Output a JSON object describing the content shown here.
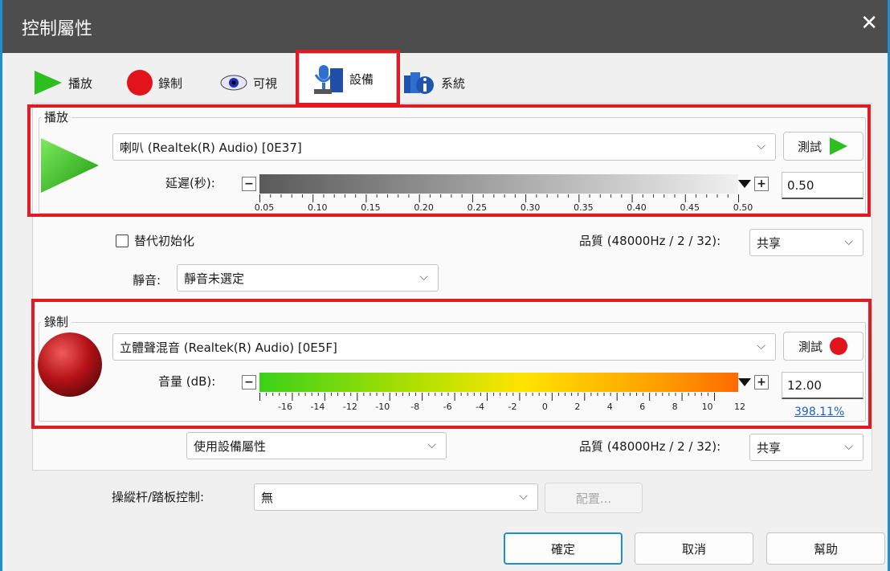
{
  "window": {
    "title": "控制屬性",
    "close_glyph": "✕"
  },
  "tabs": [
    {
      "label": "播放",
      "icon": "play-icon"
    },
    {
      "label": "錄制",
      "icon": "record-icon"
    },
    {
      "label": "可視",
      "icon": "eye-icon"
    },
    {
      "label": "設備",
      "icon": "device-icon",
      "active": true
    },
    {
      "label": "系統",
      "icon": "system-info-icon"
    }
  ],
  "playback": {
    "group_label": "播放",
    "device": "喇叭 (Realtek(R) Audio) [0E37]",
    "test_label": "測試",
    "latency_label": "延遲(秒):",
    "latency_value": "0.50",
    "latency_level": 1.0,
    "latency_ticks": [
      "0.05",
      "0.10",
      "0.15",
      "0.20",
      "0.25",
      "0.30",
      "0.35",
      "0.40",
      "0.45",
      "0.50"
    ]
  },
  "options": {
    "alt_init_label": "替代初始化",
    "alt_init_checked": false,
    "quality_label": "品質 (48000Hz / 2 / 32):",
    "quality_value": "共享",
    "mute_label": "靜音:",
    "mute_value": "靜音未選定"
  },
  "record": {
    "group_label": "錄制",
    "device": "立體聲混音 (Realtek(R) Audio) [0E5F]",
    "test_label": "測試",
    "volume_label": "音量 (dB):",
    "volume_value": "12.00",
    "volume_percent": "398.11%",
    "volume_ticks": [
      "-16",
      "-14",
      "-12",
      "-10",
      "-8",
      "-6",
      "-4",
      "-2",
      "0",
      "2",
      "4",
      "6",
      "8",
      "10",
      "12"
    ],
    "device_props": "使用設備屬性",
    "quality_label": "品質 (48000Hz / 2 / 32):",
    "quality_value": "共享"
  },
  "joystick": {
    "label": "操縱杆/踏板控制:",
    "value": "無",
    "config_label": "配置..."
  },
  "footer": {
    "ok": "確定",
    "cancel": "取消",
    "help": "幫助"
  },
  "colors": {
    "accent": "#1e8ecf",
    "highlight": "#e01b24",
    "titlebar": "#4d4d4d",
    "play_green": "#2dbf1f",
    "record_red": "#c8161b"
  }
}
